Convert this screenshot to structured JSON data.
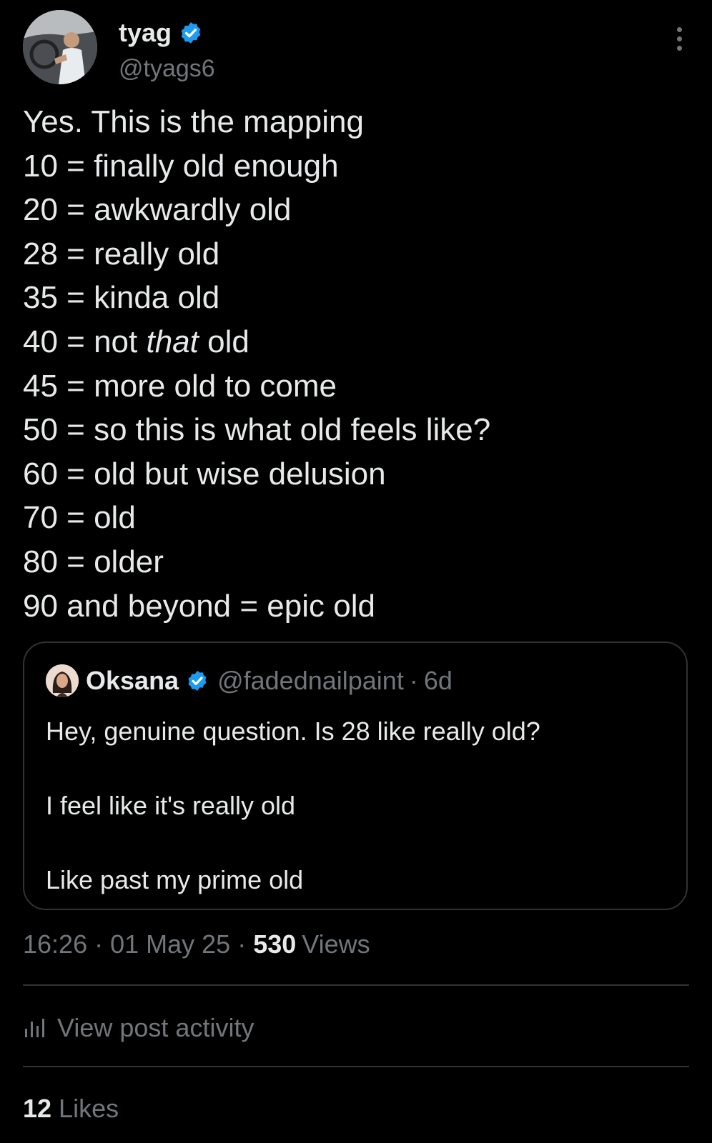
{
  "author": {
    "display_name": "tyag",
    "handle": "@tyags6",
    "verified": true,
    "avatar_icon": "person-driving-car-photo"
  },
  "tweet": {
    "lines": [
      "Yes. This is the mapping",
      "10 = finally old enough",
      "20 = awkwardly old",
      "28 = really old",
      "35 = kinda old",
      "50 = so this is what old feels like?",
      "60 = old but wise delusion",
      "70 = old",
      "80 = older",
      "90 and beyond = epic old"
    ],
    "line_40": {
      "prefix": "40 = not ",
      "italic": "that",
      "suffix": " old"
    },
    "line_45": "45 = more old to come"
  },
  "quote": {
    "display_name": "Oksana",
    "handle": "@fadednailpaint",
    "dot": "·",
    "time": "6d",
    "verified": true,
    "paragraphs": [
      "Hey, genuine question. Is 28 like really old?",
      "I feel like it's really old",
      "Like past my prime old"
    ]
  },
  "meta": {
    "time": "16:26",
    "date": "01 May 25",
    "dot": "·",
    "views_count": "530",
    "views_label": "Views"
  },
  "activity": {
    "label": "View post activity",
    "icon": "bar-chart-icon"
  },
  "likes": {
    "count": "12",
    "label": "Likes"
  },
  "colors": {
    "background": "#000000",
    "text_primary": "#e7e9ea",
    "text_secondary": "#71767b",
    "verified_blue": "#1d9bf0",
    "border": "#2f3336"
  }
}
